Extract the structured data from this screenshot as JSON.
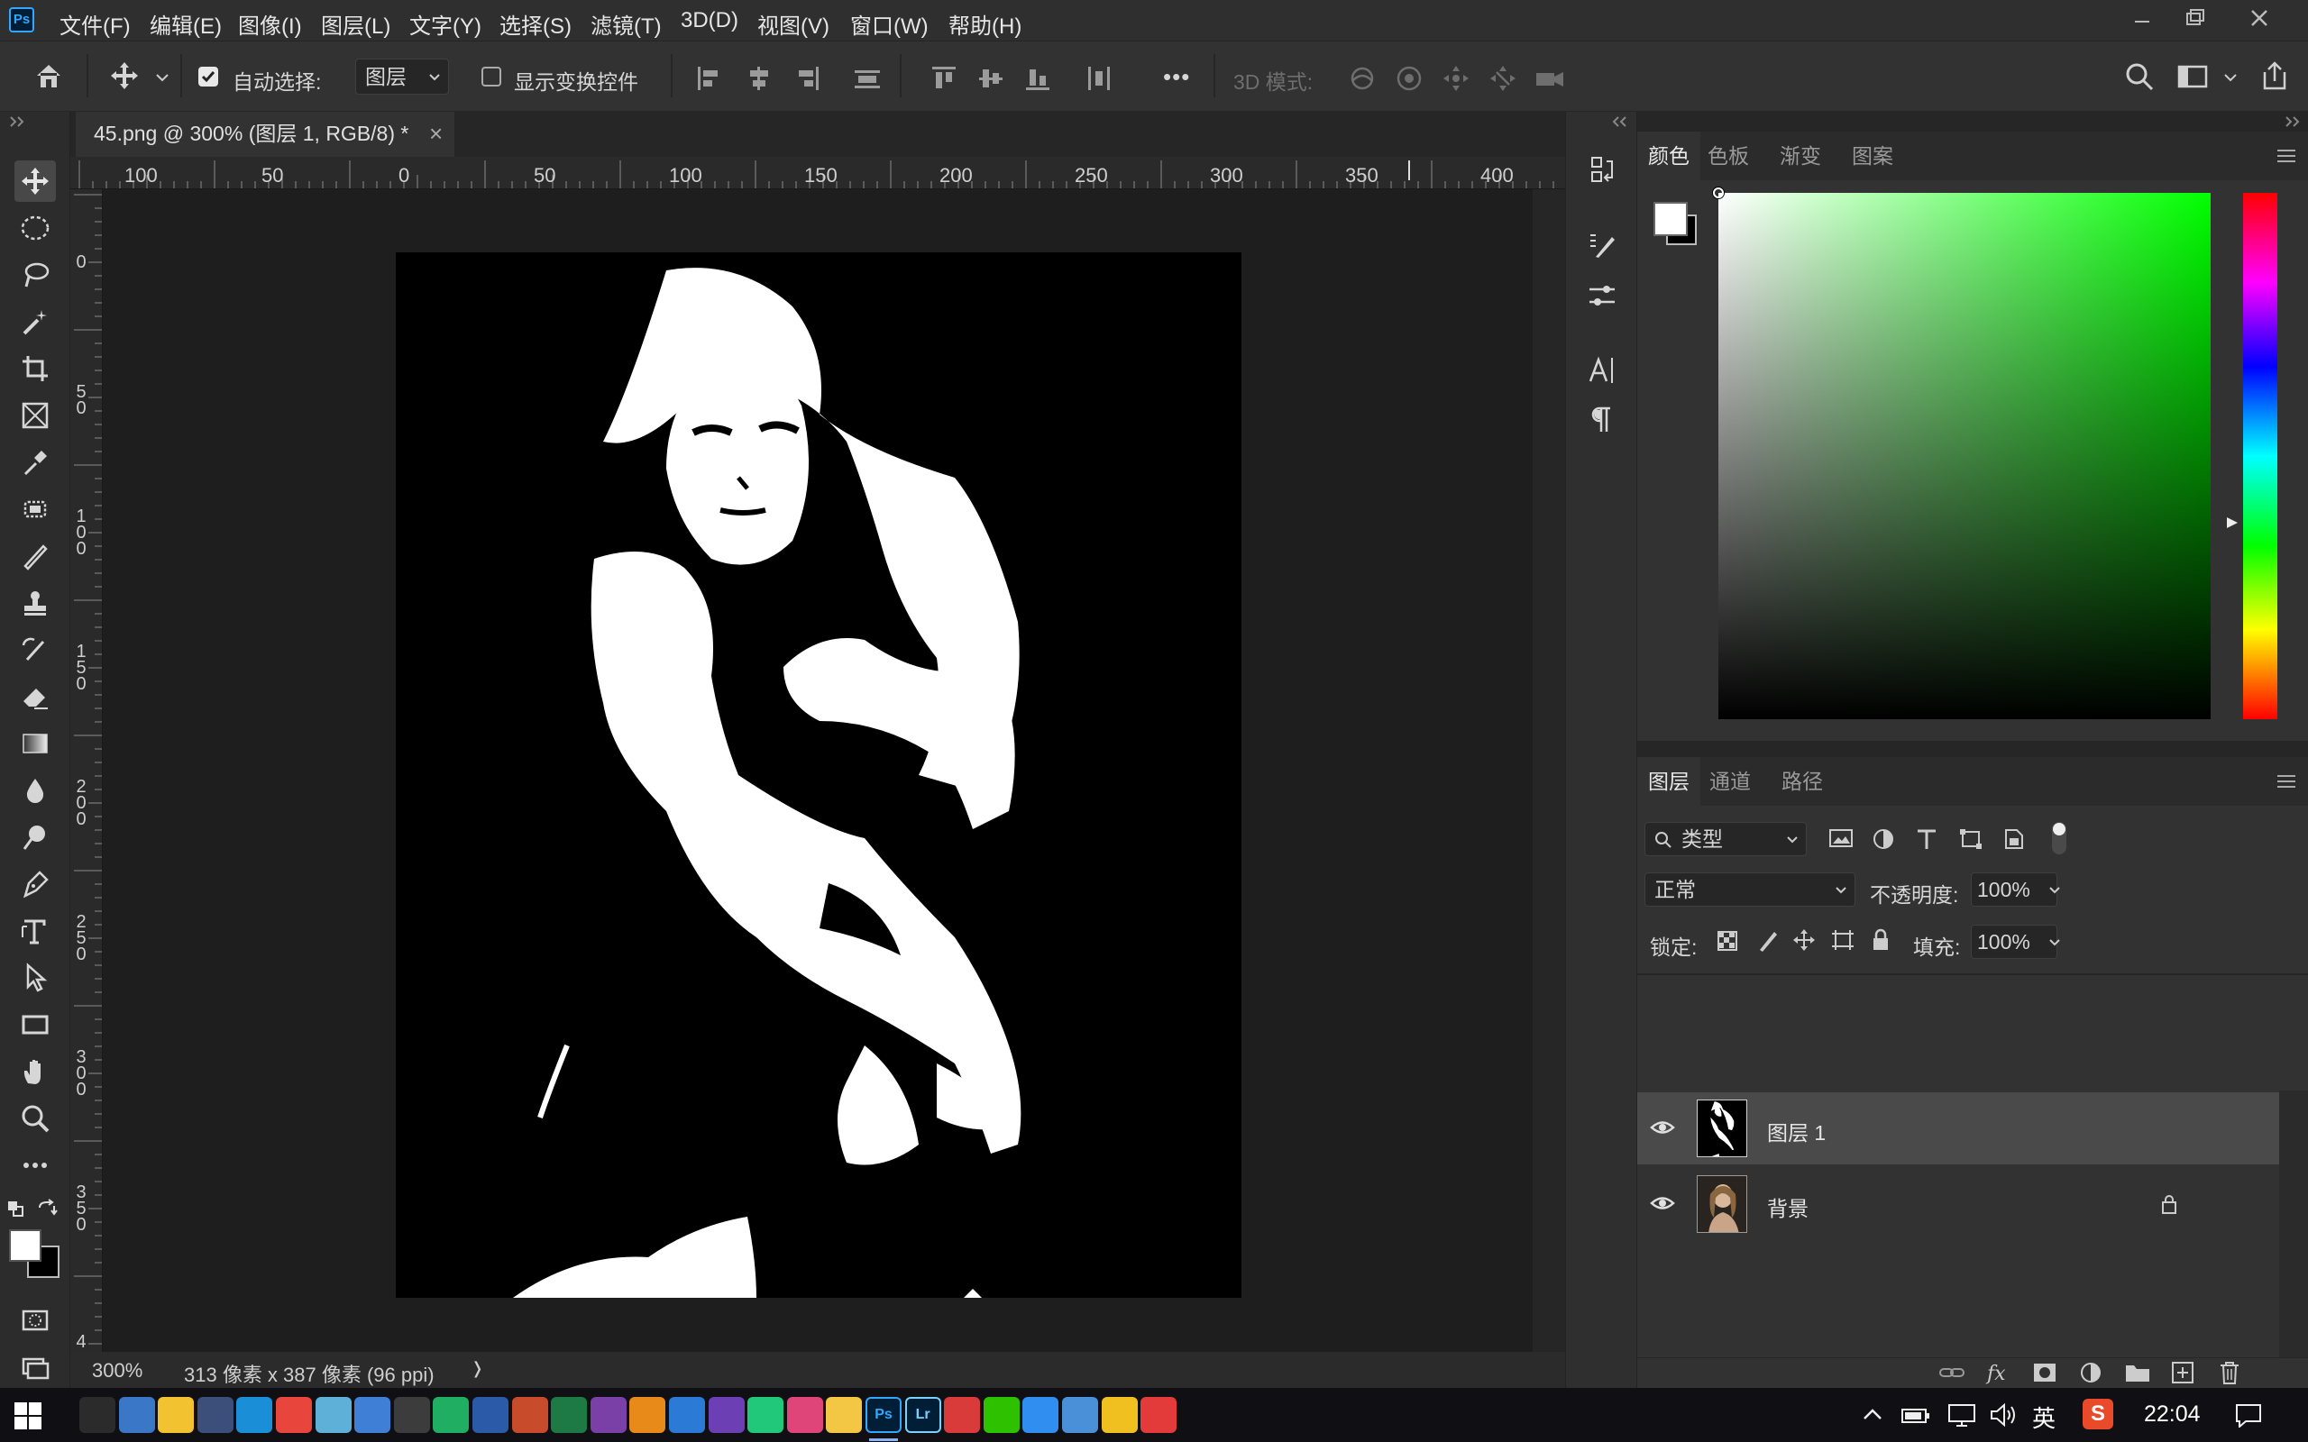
{
  "app": {
    "logo": "Ps"
  },
  "menu": {
    "items": [
      "文件(F)",
      "编辑(E)",
      "图像(I)",
      "图层(L)",
      "文字(Y)",
      "选择(S)",
      "滤镜(T)",
      "3D(D)",
      "视图(V)",
      "窗口(W)",
      "帮助(H)"
    ]
  },
  "options_bar": {
    "auto_select_label": "自动选择:",
    "auto_select_checked": true,
    "auto_select_target": "图层",
    "show_transform_label": "显示变换控件",
    "show_transform_checked": false,
    "more_label": "•••",
    "mode_3d_label": "3D 模式:"
  },
  "document": {
    "tab_title": "45.png @ 300% (图层 1, RGB/8) *",
    "close_glyph": "×",
    "zoom": "300%",
    "size_info": "313 像素 x 387 像素 (96 ppi)",
    "status_arrow": "❭"
  },
  "rulers": {
    "horizontal": [
      "100",
      "50",
      "0",
      "50",
      "100",
      "150",
      "200",
      "250",
      "300",
      "350",
      "400"
    ],
    "vertical": [
      "0",
      "5\n0",
      "1\n0\n0",
      "1\n5\n0",
      "2\n0\n0",
      "2\n5\n0",
      "3\n0\n0",
      "3\n5\n0",
      "4"
    ]
  },
  "tools": [
    "move-tool",
    "marquee-tool",
    "lasso-tool",
    "magic-wand-tool",
    "crop-tool",
    "frame-tool",
    "eyedropper-tool",
    "patch-tool",
    "brush-tool",
    "stamp-tool",
    "history-brush-tool",
    "eraser-tool",
    "gradient-tool",
    "blur-tool",
    "dodge-tool",
    "pen-tool",
    "type-tool",
    "path-select-tool",
    "rectangle-tool",
    "hand-tool",
    "zoom-tool",
    "more-tools"
  ],
  "color_panel": {
    "tabs": [
      "颜色",
      "色板",
      "渐变",
      "图案"
    ],
    "active_tab": "颜色",
    "foreground": "#ffffff",
    "background": "#000000",
    "hue_color": "#00ff00"
  },
  "layers_panel": {
    "tabs": [
      "图层",
      "通道",
      "路径"
    ],
    "active_tab": "图层",
    "filter_label": "类型",
    "blend_mode": "正常",
    "opacity_label": "不透明度:",
    "opacity_value": "100%",
    "lock_label": "锁定:",
    "fill_label": "填充:",
    "fill_value": "100%",
    "layers": [
      {
        "name": "图层 1",
        "visible": true,
        "selected": true,
        "locked": false
      },
      {
        "name": "背景",
        "visible": true,
        "selected": false,
        "locked": true
      }
    ]
  },
  "taskbar": {
    "time": "22:04",
    "ime": "英",
    "apps": [
      "terminal",
      "explorer-app",
      "file-explorer",
      "calculator",
      "edge",
      "chrome",
      "notes",
      "paint",
      "typora",
      "mindmaster",
      "word",
      "powerpoint",
      "excel",
      "onenote",
      "sublime",
      "vscode",
      "visual-studio",
      "pycharm",
      "intellij",
      "sticky-notes",
      "photoshop",
      "lightroom",
      "qq-music",
      "wechat",
      "feishu",
      "bag-app",
      "avatar-app",
      "netease-music"
    ]
  }
}
